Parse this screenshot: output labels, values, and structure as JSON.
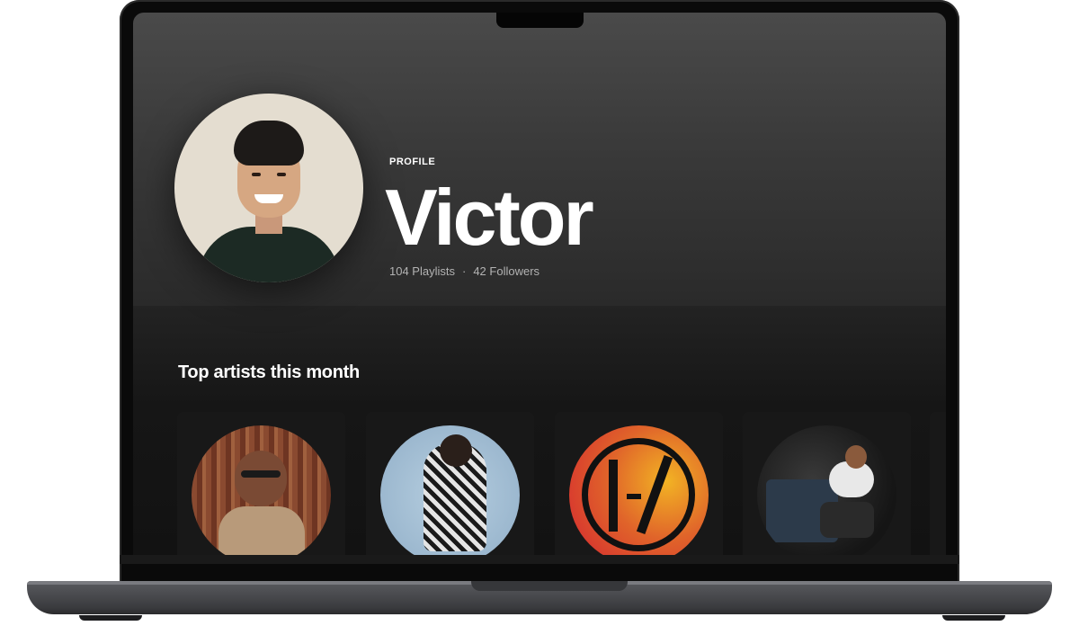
{
  "profile": {
    "label": "PROFILE",
    "name": "Victor",
    "playlists": "104 Playlists",
    "separator": "·",
    "followers": "42 Followers"
  },
  "section": {
    "title": "Top artists this month"
  },
  "artists": [
    {
      "image": "artist-bruno-mars-photo"
    },
    {
      "image": "artist-future-photo"
    },
    {
      "image": "artist-twenty-one-pilots-logo"
    },
    {
      "image": "artist-j-cole-photo"
    }
  ],
  "colors": {
    "hero_bg": "#4a4a4a",
    "page_bg": "#121212",
    "card_bg": "#181818",
    "text_primary": "#ffffff",
    "text_secondary": "#b3b3b3"
  }
}
